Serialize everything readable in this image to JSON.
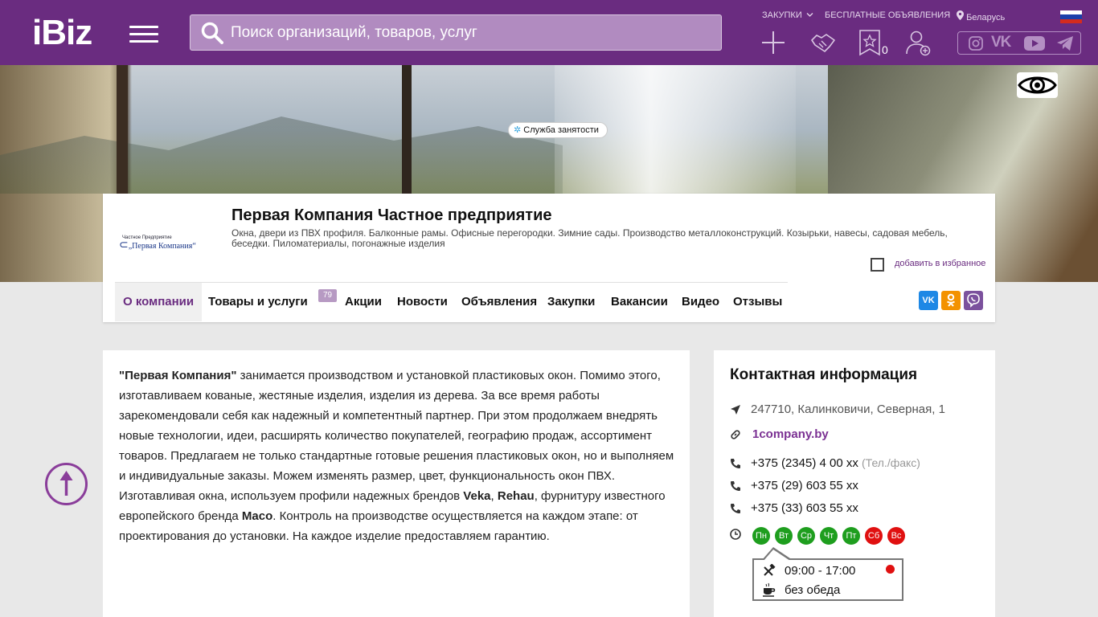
{
  "header": {
    "logo": "iBiz",
    "search_placeholder": "Поиск организаций, товаров, услуг",
    "links": {
      "purchases": "ЗАКУПКИ",
      "free_ads": "БЕСПЛАТНЫЕ ОБЪЯВЛЕНИЯ",
      "region": "Беларусь"
    },
    "favorites_count": "0",
    "brand_color": "#6a2c80"
  },
  "company": {
    "name": "Первая Компания Частное предприятие",
    "description": "Окна, двери из ПВХ профиля. Балконные рамы. Офисные перегородки. Зимние сады. Производство металлоконструкций. Козырьки, навесы, садовая мебель, беседки. Пиломатериалы, погонажные изделия",
    "logo_line1": "Частное Предприятие",
    "logo_line2": "„Первая Компания“",
    "add_to_favorites": "добавить в избранное"
  },
  "nav": {
    "items": [
      {
        "label": "О компании",
        "active": true
      },
      {
        "label": "Товары и услуги",
        "badge": "79"
      },
      {
        "label": "Акции"
      },
      {
        "label": "Новости"
      },
      {
        "label": "Объявления"
      },
      {
        "label": "Закупки"
      },
      {
        "label": "Вакансии"
      },
      {
        "label": "Видео"
      },
      {
        "label": "Отзывы"
      }
    ],
    "vacancy_sub": "Служба занятости"
  },
  "share": {
    "vk": "vk-icon",
    "ok": "odnoklassniki-icon",
    "viber": "viber-icon"
  },
  "about": {
    "p1_brand": "\"Первая Компания\"",
    "p1_rest": " занимается производством и установкой пластиковых окон. Помимо этого, изготавливаем кованые, жестяные изделия, изделия из дерева. За все время работы зарекомендовали себя как надежный и компетентный партнер. При этом продолжаем внедрять новые технологии, идеи, расширять количество покупателей, географию продаж, ассортимент товаров. Предлагаем не только стандартные готовые решения пластиковых окон, но и выполняем и индивидуальные заказы. Можем изменять размер, цвет, функциональность окон ПВХ.",
    "p2_a": "Изготавливая окна, используем профили надежных брендов ",
    "brand1": "Veka",
    "p2_comma": ", ",
    "brand2": "Rehau",
    "p2_b": ", фурнитуру известного европейского бренда ",
    "brand3": "Maco",
    "p2_c": ". Контроль на производстве осуществляется на каждом этапе: от проектирования до установки. На каждое изделие предоставляем гарантию."
  },
  "contact": {
    "title": "Контактная информация",
    "address": "247710, Калинковичи, Северная, 1",
    "website": "1company.by",
    "phones": [
      {
        "number": "+375 (2345) 4 00 xx",
        "note": "(Тел./факс)"
      },
      {
        "number": "+375 (29) 603 55 xx",
        "note": ""
      },
      {
        "number": "+375 (33) 603 55 xx",
        "note": ""
      }
    ],
    "days": [
      {
        "label": "Пн",
        "status": "work"
      },
      {
        "label": "Вт",
        "status": "work"
      },
      {
        "label": "Ср",
        "status": "work"
      },
      {
        "label": "Чт",
        "status": "work"
      },
      {
        "label": "Пт",
        "status": "work"
      },
      {
        "label": "Сб",
        "status": "off"
      },
      {
        "label": "Вс",
        "status": "off"
      }
    ],
    "hours": "09:00 - 17:00",
    "lunch": "без обеда",
    "work_color": "#1e9e1e",
    "off_color": "#e01010"
  }
}
